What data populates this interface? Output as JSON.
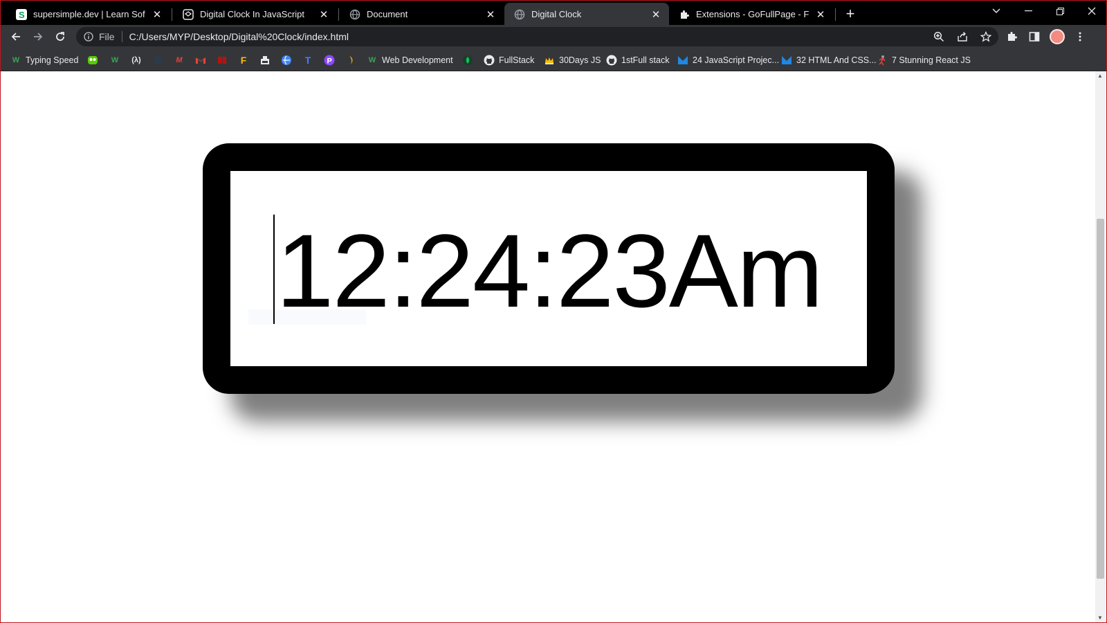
{
  "browser": {
    "tabs": [
      {
        "title": "supersimple.dev | Learn Software",
        "icon": "supersimple-favicon"
      },
      {
        "title": "Digital Clock In JavaScript",
        "icon": "codepen-favicon"
      },
      {
        "title": "Document",
        "icon": "globe-favicon"
      },
      {
        "title": "Digital Clock",
        "icon": "globe-favicon"
      },
      {
        "title": "Extensions - GoFullPage - Full Pa",
        "icon": "puzzle-favicon"
      }
    ],
    "active_tab": 3,
    "address": {
      "scheme_label": "File",
      "url": "C:/Users/MYP/Desktop/Digital%20Clock/index.html"
    },
    "bookmarks": [
      {
        "label": "Typing Speed",
        "icon": "w-icon"
      },
      {
        "label": "",
        "icon": "duolingo-icon"
      },
      {
        "label": "",
        "icon": "w-icon"
      },
      {
        "label": "",
        "icon": "lambda-icon"
      },
      {
        "label": "",
        "icon": "blank-icon"
      },
      {
        "label": "",
        "icon": "m-icon"
      },
      {
        "label": "",
        "icon": "gmail-icon"
      },
      {
        "label": "",
        "icon": "book-icon"
      },
      {
        "label": "",
        "icon": "f-icon"
      },
      {
        "label": "",
        "icon": "tray-icon"
      },
      {
        "label": "",
        "icon": "globe-icon"
      },
      {
        "label": "",
        "icon": "t-icon"
      },
      {
        "label": "",
        "icon": "p-icon"
      },
      {
        "label": "",
        "icon": "drop-icon"
      },
      {
        "label": "Web Development",
        "icon": "w-icon"
      },
      {
        "label": "",
        "icon": "leaf-icon"
      },
      {
        "label": "FullStack",
        "icon": "github-icon"
      },
      {
        "label": "30Days JS",
        "icon": "crown-icon"
      },
      {
        "label": "1stFull stack",
        "icon": "github-icon"
      },
      {
        "label": "24 JavaScript Projec...",
        "icon": "m-blue-icon"
      },
      {
        "label": "32 HTML And CSS...",
        "icon": "m-blue-icon"
      },
      {
        "label": "7 Stunning React JS",
        "icon": "figure-icon"
      }
    ]
  },
  "page": {
    "clock_time": "12:24:23Am",
    "ghost_text": "Snip"
  },
  "colors": {
    "frame": "#000000",
    "face": "#ffffff",
    "shadow": "#7f7f7f",
    "chrome_dark": "#35363a"
  }
}
